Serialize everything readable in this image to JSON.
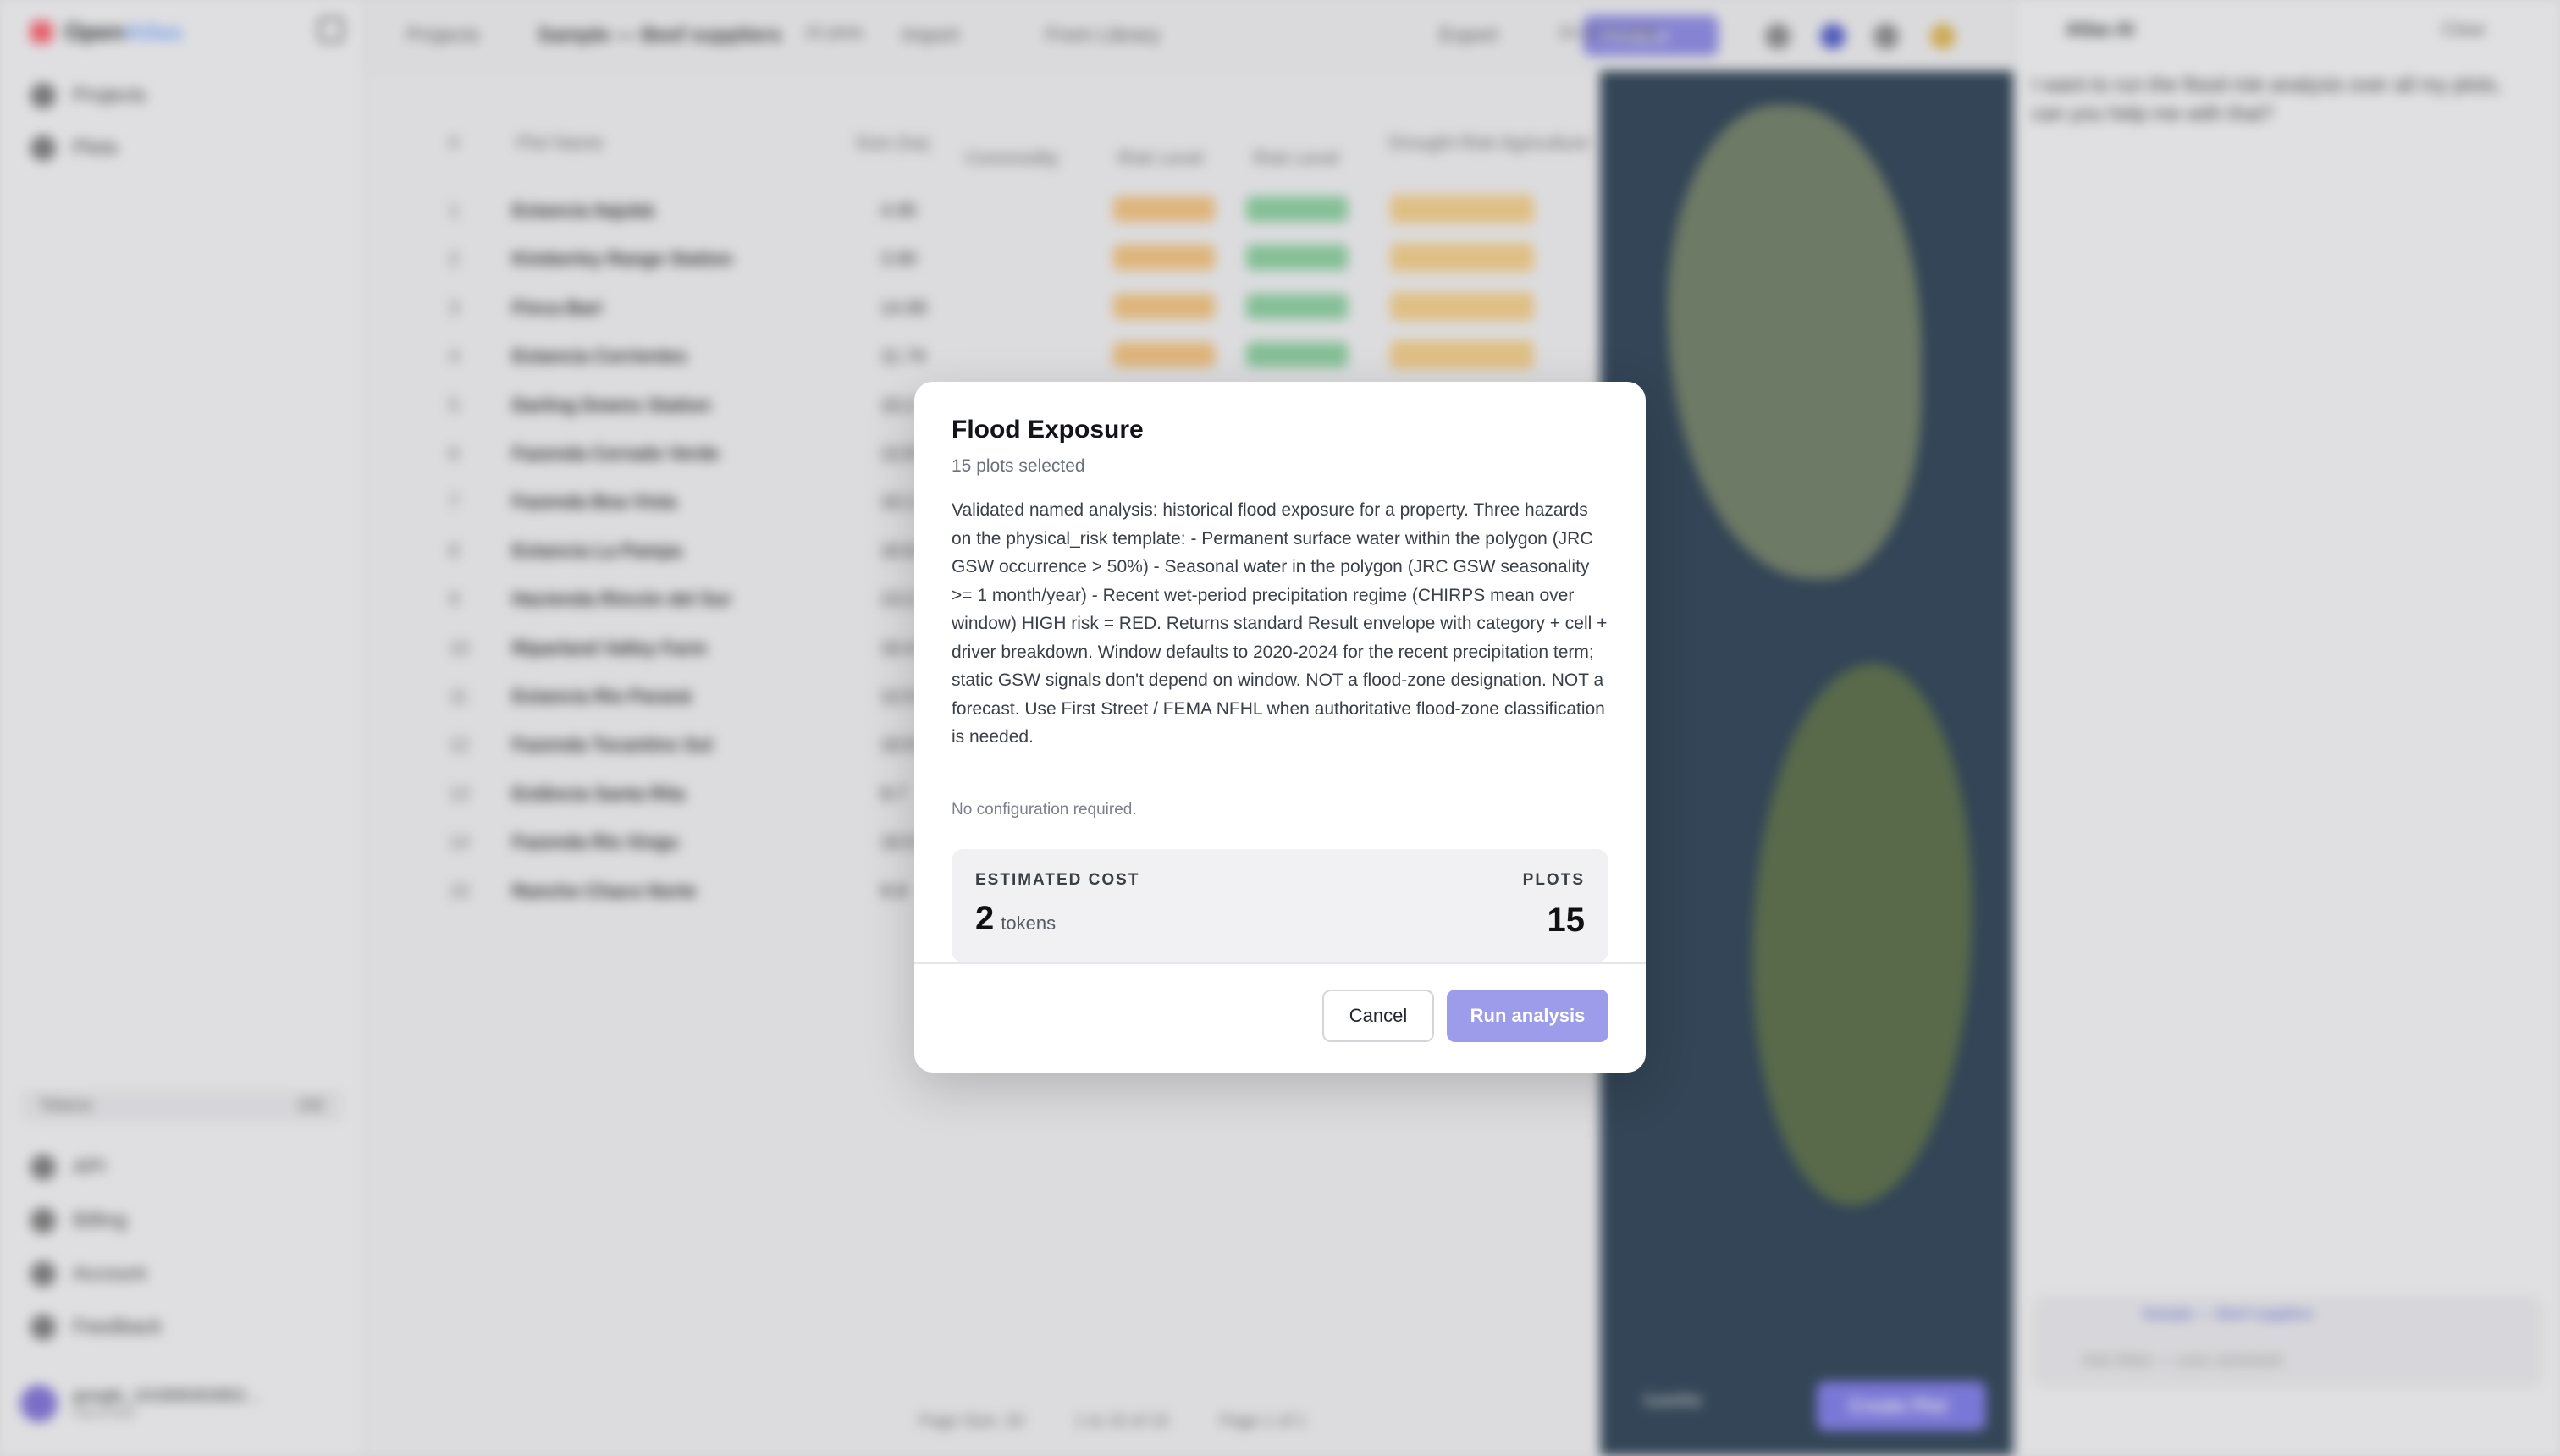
{
  "app": {
    "name_part1": "Open",
    "name_part2": "Atlas",
    "nav": [
      {
        "label": "Projects",
        "icon": "folder-icon"
      },
      {
        "label": "Plots",
        "icon": "map-pin-icon"
      }
    ],
    "bottom_nav": [
      {
        "label": "API",
        "icon": "key-icon"
      },
      {
        "label": "Billing",
        "icon": "card-icon"
      },
      {
        "label": "Account",
        "icon": "user-icon"
      },
      {
        "label": "Feedback",
        "icon": "chat-icon"
      }
    ],
    "trial": {
      "label": "Tokens",
      "value": "192"
    },
    "user": {
      "name": "google_101806303952…",
      "sub": "OpenAtlas"
    },
    "topbar": {
      "back_label": "Projects",
      "title": "Sample — Beef suppliers",
      "count": "15 plots",
      "import_label": "Import",
      "library_label": "From Library",
      "analyse_label": "Analyse",
      "export_label": "Export",
      "selection": "15 of 15 plots"
    },
    "table": {
      "headers": [
        "#",
        "Plot Name",
        "Size (ha)",
        "Commodity",
        "Risk Level",
        "Risk Level",
        "Drought Risk Agriculture"
      ],
      "rows": [
        {
          "num": "1",
          "name": "Estancia Itajubá",
          "size": "4.95"
        },
        {
          "num": "2",
          "name": "Kimberley Range Station",
          "size": "3.90"
        },
        {
          "num": "3",
          "name": "Finca Bari",
          "size": "14.90"
        },
        {
          "num": "4",
          "name": "Estancia Corrientes",
          "size": "11.74"
        },
        {
          "num": "5",
          "name": "Darling Downs Station",
          "size": "10.2"
        },
        {
          "num": "6",
          "name": "Fazenda Cerrado Verde",
          "size": "12.8"
        },
        {
          "num": "7",
          "name": "Fazenda Boa Vista",
          "size": "10.1"
        },
        {
          "num": "8",
          "name": "Estancia La Pampa",
          "size": "10.6"
        },
        {
          "num": "9",
          "name": "Hacienda Rincón del Sur",
          "size": "13.2"
        },
        {
          "num": "10",
          "name": "Riparland Valley Farm",
          "size": "10.4"
        },
        {
          "num": "11",
          "name": "Estancia Rio Paraná",
          "size": "12.0"
        },
        {
          "num": "12",
          "name": "Fazenda Tocantins Sul",
          "size": "10.9"
        },
        {
          "num": "13",
          "name": "Estância Santa Rita",
          "size": "9.7"
        },
        {
          "num": "14",
          "name": "Fazenda Rio Xingu",
          "size": "10.5"
        },
        {
          "num": "15",
          "name": "Rancho Chaco Norte",
          "size": "9.9"
        }
      ],
      "pagination": {
        "page_size": "Page Size: 20",
        "range": "1 to 15 of 15",
        "page": "Page 1 of 1"
      }
    },
    "map": {
      "layer_label": "Satellite",
      "create_plot": "Create Plot"
    },
    "chat": {
      "title": "Atlas AI",
      "clear": "Clear",
      "message": "I want to run the flood risk analysis over all my plots, can you help me with that?",
      "context": "Sample — Beef suppliers",
      "input_placeholder": "Ask Atlas — your assistant"
    }
  },
  "modal": {
    "title": "Flood Exposure",
    "subtitle": "15 plots selected",
    "description": "Validated named analysis: historical flood exposure for a property. Three hazards on the physical_risk template: - Permanent surface water within the polygon (JRC GSW occurrence > 50%) - Seasonal water in the polygon (JRC GSW seasonality >= 1 month/year) - Recent wet-period precipitation regime (CHIRPS mean over window) HIGH risk = RED. Returns standard Result envelope with category + cell + driver breakdown. Window defaults to 2020-2024 for the recent precipitation term; static GSW signals don't depend on window. NOT a flood-zone designation. NOT a forecast. Use First Street / FEMA NFHL when authoritative flood-zone classification is needed.",
    "no_config": "No configuration required.",
    "cost_label": "ESTIMATED COST",
    "cost_value": "2",
    "cost_unit": "tokens",
    "plots_label": "PLOTS",
    "plots_value": "15",
    "cancel_label": "Cancel",
    "run_label": "Run analysis"
  },
  "colors": {
    "primary": "#9d9ceb",
    "overlay": "rgba(120,120,126,0.18)",
    "text_dark": "#121418",
    "text_muted": "#6b7079"
  }
}
